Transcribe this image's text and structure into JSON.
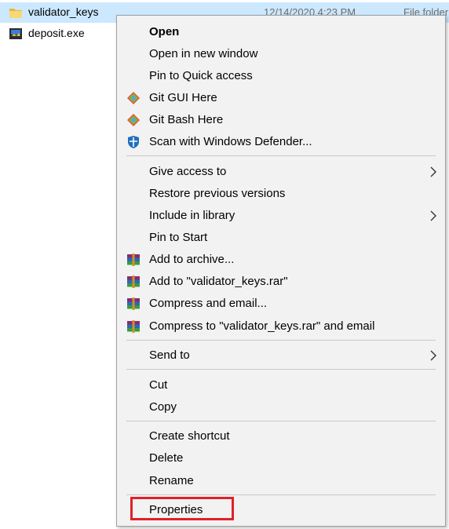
{
  "files": [
    {
      "name": "validator_keys",
      "date": "12/14/2020 4:23 PM",
      "type": "File folder",
      "icon": "folder-icon",
      "selected": true
    },
    {
      "name": "deposit.exe",
      "icon": "exe-icon"
    }
  ],
  "menu": {
    "open": "Open",
    "open_new_window": "Open in new window",
    "pin_quick_access": "Pin to Quick access",
    "git_gui": "Git GUI Here",
    "git_bash": "Git Bash Here",
    "scan_defender": "Scan with Windows Defender...",
    "give_access": "Give access to",
    "restore_versions": "Restore previous versions",
    "include_library": "Include in library",
    "pin_start": "Pin to Start",
    "add_archive": "Add to archive...",
    "add_rar": "Add to \"validator_keys.rar\"",
    "compress_email": "Compress and email...",
    "compress_rar_email": "Compress to \"validator_keys.rar\" and email",
    "send_to": "Send to",
    "cut": "Cut",
    "copy": "Copy",
    "create_shortcut": "Create shortcut",
    "delete": "Delete",
    "rename": "Rename",
    "properties": "Properties"
  },
  "colors": {
    "selection": "#cce8ff",
    "menu_bg": "#f2f2f2",
    "highlight": "#e0202a"
  }
}
